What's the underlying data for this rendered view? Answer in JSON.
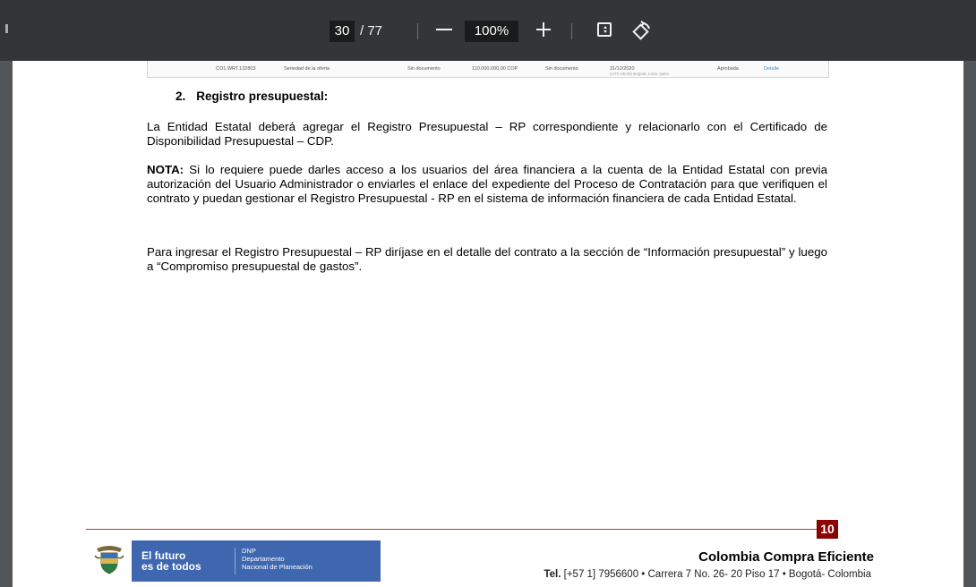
{
  "toolbar": {
    "page_current": "30",
    "page_total": "/ 77",
    "zoom": "100%",
    "icons": [
      "zoom-out-icon",
      "zoom-in-icon",
      "fit-page-icon",
      "rotate-icon"
    ]
  },
  "prev_table": {
    "code": "CO1.WRT.132803",
    "concept": "Seriedad de la oferta",
    "doc1": "Sin documento",
    "amount": "110.000.000,00 COP",
    "doc2": "Sin documento",
    "date": "31/12/2020",
    "date_note": "(UTC-05:00) Bogotá, Lima, Quito",
    "status": "Aprobada",
    "link": "Detalle"
  },
  "document": {
    "heading_number": "2.",
    "heading_text": "Registro presupuestal:",
    "p1": "La Entidad Estatal deberá agregar el Registro Presupuestal – RP correspondiente y relacionarlo con el Certificado de Disponibilidad Presupuestal – CDP.",
    "nota_label": "NOTA:",
    "nota_text": " Si lo requiere puede darles acceso a los usuarios del área financiera a la cuenta de la Entidad Estatal con previa autorización del Usuario Administrador o enviarles el enlace del expediente del Proceso de Contratación para que verifiquen el contrato y puedan gestionar el Registro Presupuestal - RP en el sistema de información financiera de cada Entidad Estatal.",
    "p3": "Para ingresar el Registro Presupuestal – RP diríjase en el detalle del contrato a la sección de “Información presupuestal” y luego a “Compromiso presupuestal de gastos”."
  },
  "footer": {
    "page_number": "10",
    "futuro_line1": "El futuro",
    "futuro_line2": "es de todos",
    "dnp_line1": "DNP",
    "dnp_line2": "Departamento",
    "dnp_line3": "Nacional de Planeación",
    "brand": "Colombia Compra Eficiente",
    "tel_label": "Tel.",
    "contact": " [+57 1] 7956600 • Carrera 7 No. 26- 20 Piso 17 • Bogotá- Colombia"
  },
  "colors": {
    "toolbar": "#323639",
    "viewer_bg": "#525659",
    "accent_red": "#c0392b",
    "banner_blue": "#3e67b0"
  }
}
